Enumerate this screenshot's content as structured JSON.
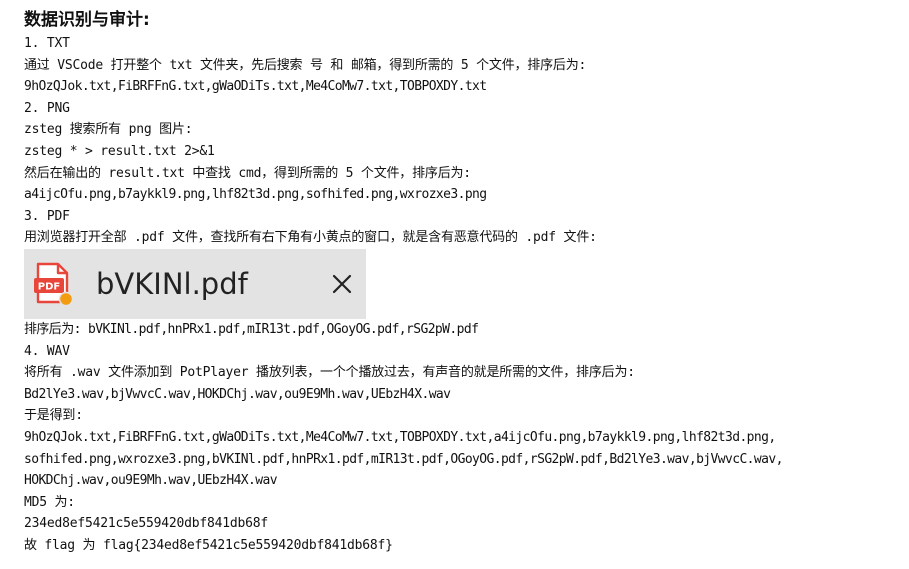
{
  "title": "数据识别与审计:",
  "sections": {
    "txt": {
      "heading": "1.  TXT",
      "desc": "通过 VSCode 打开整个 txt 文件夹，先后搜索 号 和 邮箱，得到所需的 5 个文件，排序后为:",
      "files": "9hOzQJok.txt,FiBRFFnG.txt,gWaODiTs.txt,Me4CoMw7.txt,TOBPOXDY.txt"
    },
    "png": {
      "heading": "2.  PNG",
      "desc": "zsteg 搜索所有 png 图片:",
      "command": "zsteg * > result.txt 2>&1",
      "desc2": "然后在输出的 result.txt 中查找 cmd，得到所需的 5 个文件，排序后为:",
      "files": "a4ijcOfu.png,b7aykkl9.png,lhf82t3d.png,sofhifed.png,wxrozxe3.png"
    },
    "pdf": {
      "heading": "3.  PDF",
      "desc": "用浏览器打开全部 .pdf 文件，查找所有右下角有小黄点的窗口，就是含有恶意代码的 .pdf 文件:",
      "tab": {
        "icon_label": "PDF",
        "filename": "bVKINl.pdf",
        "close_glyph": "×"
      },
      "files": "排序后为: bVKINl.pdf,hnPRx1.pdf,mIR13t.pdf,OGoyOG.pdf,rSG2pW.pdf"
    },
    "wav": {
      "heading": "4.  WAV",
      "desc": "将所有 .wav 文件添加到 PotPlayer 播放列表，一个个播放过去，有声音的就是所需的文件，排序后为:",
      "files": "Bd2lYe3.wav,bjVwvcC.wav,HOKDChj.wav,ou9E9Mh.wav,UEbzH4X.wav"
    }
  },
  "result": {
    "intro": "于是得到:",
    "line1": "9hOzQJok.txt,FiBRFFnG.txt,gWaODiTs.txt,Me4CoMw7.txt,TOBPOXDY.txt,a4ijcOfu.png,b7aykkl9.png,lhf82t3d.png,",
    "line2": "sofhifed.png,wxrozxe3.png,bVKINl.pdf,hnPRx1.pdf,mIR13t.pdf,OGoyOG.pdf,rSG2pW.pdf,Bd2lYe3.wav,bjVwvcC.wav,",
    "line3": "HOKDChj.wav,ou9E9Mh.wav,UEbzH4X.wav",
    "md5_label": "MD5 为:",
    "md5": "234ed8ef5421c5e559420dbf841db68f",
    "flag": "故 flag 为 flag{234ed8ef5421c5e559420dbf841db68f}"
  },
  "colors": {
    "pdf_icon_red": "#e8463a",
    "pdf_dot_orange": "#f39c12",
    "tab_bg": "#e3e3e3"
  }
}
